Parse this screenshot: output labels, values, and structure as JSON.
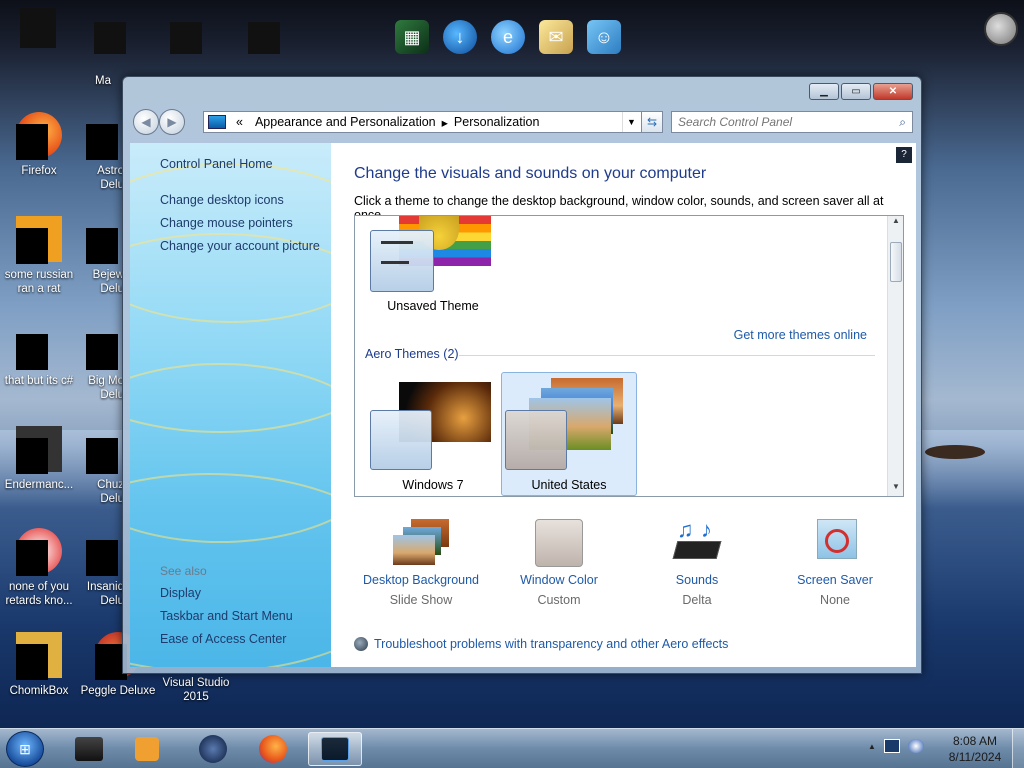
{
  "desktop": {
    "icons": [
      {
        "label": "Firefox"
      },
      {
        "label": "Astro\nDelu"
      },
      {
        "label": "some russian\nran a rat"
      },
      {
        "label": "Bejew\nDelu"
      },
      {
        "label": "that but its c#"
      },
      {
        "label": "Big Mo\nDelu"
      },
      {
        "label": "Endermanc..."
      },
      {
        "label": "Chuz\nDelu"
      },
      {
        "label": "none of you\nretards kno..."
      },
      {
        "label": "Insaniq\nDelu"
      },
      {
        "label": "ChomikBox"
      },
      {
        "label": "Peggle Deluxe"
      },
      {
        "label": "Visual Studio\n2015"
      },
      {
        "label": "Ma"
      }
    ]
  },
  "window": {
    "address": {
      "chevron": "«",
      "segments": [
        "Appearance and Personalization",
        "Personalization"
      ],
      "separator": "▸"
    },
    "search": {
      "placeholder": "Search Control Panel"
    },
    "left": {
      "home": "Control Panel Home",
      "links": [
        "Change desktop icons",
        "Change mouse pointers",
        "Change your account picture"
      ],
      "see_also_heading": "See also",
      "see_also": [
        "Display",
        "Taskbar and Start Menu",
        "Ease of Access Center"
      ]
    },
    "right": {
      "title": "Change the visuals and sounds on your computer",
      "subtitle": "Click a theme to change the desktop background, window color, sounds, and screen saver all at once.",
      "unsaved_theme": "Unsaved Theme",
      "get_more": "Get more themes online",
      "aero_heading": "Aero Themes (2)",
      "aero_themes": [
        {
          "name": "Windows 7",
          "selected": false
        },
        {
          "name": "United States",
          "selected": true
        }
      ],
      "options": [
        {
          "name": "Desktop Background",
          "value": "Slide Show"
        },
        {
          "name": "Window Color",
          "value": "Custom"
        },
        {
          "name": "Sounds",
          "value": "Delta"
        },
        {
          "name": "Screen Saver",
          "value": "None"
        }
      ],
      "troubleshoot": "Troubleshoot problems with transparency and other Aero effects",
      "help": "?"
    }
  },
  "taskbar": {
    "clock_time": "8:08 AM",
    "clock_date": "8/11/2024",
    "tray_up_arrow": "▲"
  }
}
